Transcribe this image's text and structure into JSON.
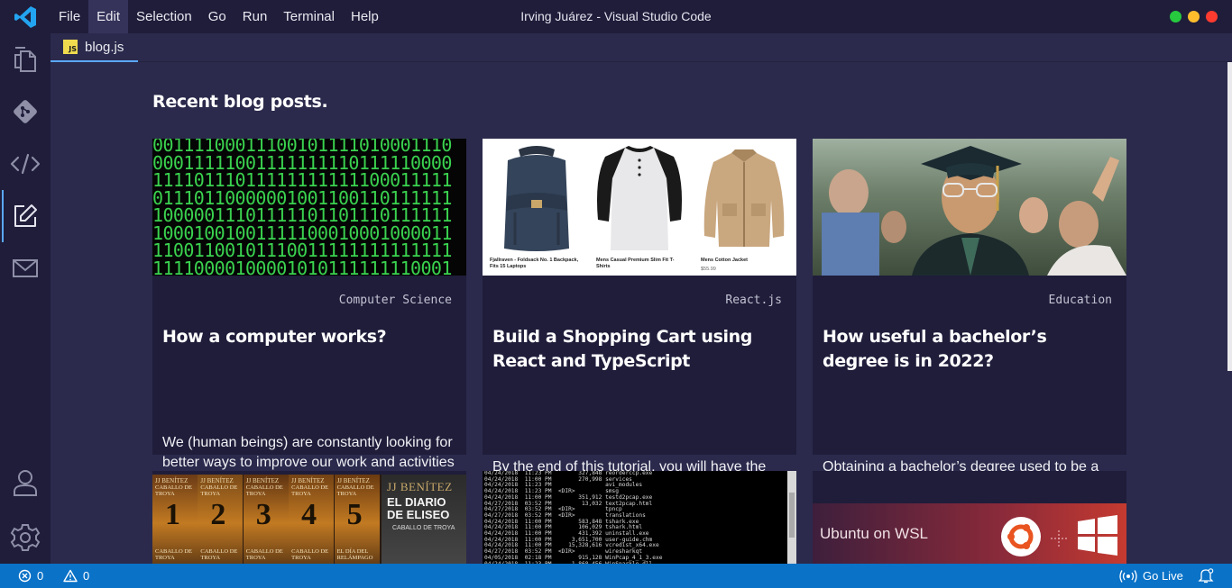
{
  "window": {
    "title": "Irving Juárez - Visual Studio Code"
  },
  "menu": {
    "items": [
      "File",
      "Edit",
      "Selection",
      "Go",
      "Run",
      "Terminal",
      "Help"
    ],
    "active": "Edit"
  },
  "window_controls": {
    "colors": [
      "#27c93f",
      "#ffbd2e",
      "#ff3b30"
    ]
  },
  "activity_bar": {
    "items": [
      "files-icon",
      "git-icon",
      "code-icon",
      "edit-icon",
      "mail-icon"
    ],
    "active": "edit-icon",
    "bottom": [
      "account-icon",
      "gear-icon"
    ],
    "accent": "#5aa8ff"
  },
  "tab": {
    "badge": "JS",
    "label": "blog.js"
  },
  "content": {
    "heading": "Recent blog posts.",
    "cards": [
      {
        "category": "Computer Science",
        "title": "How a computer works?",
        "description": "We (human beings) are constantly looking for better ways to improve our work and activities in the daily basis",
        "image": "binary-code-image",
        "binary_rows": [
          "00111100011100101111010001110",
          "00011111001111111110111110000",
          "11110111011111111111100011111",
          "01110110000001001100110111111",
          "10000011101111101101110111111",
          "10001001001111100010001000011",
          "11001100101110011111111111111",
          "11110000100001010111111110001"
        ]
      },
      {
        "category": "React.js",
        "title": "Build a Shopping Cart using React and TypeScript",
        "description": "By the end of this tutorial, you will have the key-concepts to build a Shopping Cart App using React.js with TypeScript.",
        "image": "products-image",
        "products": [
          {
            "name": "Fjallraven - Foldsack No. 1 Backpack, Fits 15 Laptops"
          },
          {
            "name": "Mens Casual Premium Slim Fit T-Shirts"
          },
          {
            "name": "Mens Cotton Jacket",
            "price": "$55.99"
          }
        ]
      },
      {
        "category": "Education",
        "title": "How useful a bachelor’s degree is in 2022?",
        "description": "Obtaining a bachelor’s degree used to be a way for students to stand out from others in a highly competitive job market.",
        "image": "graduate-photo"
      }
    ],
    "row2": [
      {
        "image": "book-covers-image",
        "author": "JJ BENÍTEZ",
        "series": "CABALLO DE TROYA",
        "numbers": [
          "1",
          "2",
          "3",
          "4",
          "5"
        ],
        "feature_title": "EL DIARIO DE ELISEO",
        "bottom_labels": [
          "CABALLO DE TROYA",
          "CABALLO DE TROYA",
          "CABALLO DE TROYA",
          "CABALLO DE TROYA",
          "EL DÍA DEL RELÁMPAGO"
        ]
      },
      {
        "image": "terminal-listing-image",
        "lines": [
          "04/24/2018  11:23 PM        327,848 reorderccp.exe",
          "04/24/2018  11:00 PM        270,998 services",
          "04/24/2018  11:23 PM                avi_modules",
          "04/24/2018  11:23 PM  <DIR>         smsg",
          "04/24/2018  11:00 PM        351,912 testd2pcap.exe",
          "04/27/2018  03:52 PM         13,032 text2pcap.html",
          "04/27/2018  03:52 PM  <DIR>         tpncp",
          "04/27/2018  03:52 PM  <DIR>         translations",
          "04/24/2018  11:00 PM        583,848 tshark.exe",
          "04/24/2018  11:00 PM        106,029 tshark.html",
          "04/24/2018  11:00 PM        431,392 uninstall.exe",
          "04/24/2018  11:00 PM      3,651,700 user-guide.chm",
          "04/24/2018  11:00 PM     15,328,616 vcredist_x64.exe",
          "04/27/2018  03:52 PM  <DIR>         wiresharkqt",
          "04/05/2018  02:18 PM        915,128 WinPcap_4_1_3.exe",
          "04/24/2018  11:23 PM      1,868,456 WinSparkle.dll"
        ]
      },
      {
        "image": "ubuntu-wsl-image",
        "banner_text": "Ubuntu on WSL"
      }
    ]
  },
  "statusbar": {
    "errors": "0",
    "warnings": "0",
    "go_live": "Go Live",
    "color": "#0a72c7"
  }
}
